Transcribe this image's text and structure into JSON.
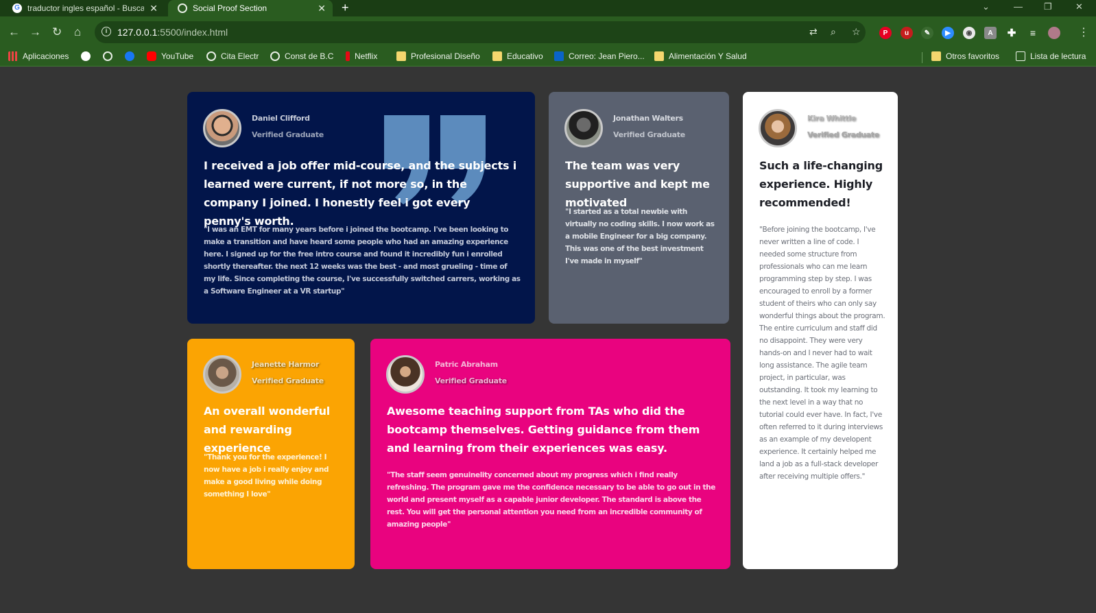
{
  "browser": {
    "tabs": [
      {
        "title": "traductor ingles español - Buscar",
        "active": false
      },
      {
        "title": "Social Proof Section",
        "active": true
      }
    ],
    "new_tab_label": "+",
    "address": {
      "host": "127.0.0.1",
      "rest": ":5500/index.html"
    },
    "bookmarks": [
      {
        "label": "Aplicaciones",
        "icon": "apps-grid-icon"
      },
      {
        "label": "",
        "icon": "google-icon"
      },
      {
        "label": "",
        "icon": "globe-icon"
      },
      {
        "label": "",
        "icon": "facebook-icon"
      },
      {
        "label": "YouTube",
        "icon": "youtube-icon"
      },
      {
        "label": "Cita Electr",
        "icon": "globe-icon"
      },
      {
        "label": "Const de B.C",
        "icon": "globe-icon"
      },
      {
        "label": "Netflix",
        "icon": "netflix-icon"
      },
      {
        "label": "Profesional Diseño",
        "icon": "folder-icon"
      },
      {
        "label": "Educativo",
        "icon": "folder-icon"
      },
      {
        "label": "Correo: Jean Piero...",
        "icon": "outlook-icon"
      },
      {
        "label": "Alimentación Y Salud",
        "icon": "folder-icon"
      }
    ],
    "other_bookmarks": "Otros favoritos",
    "reading_list": "Lista de lectura"
  },
  "colors": {
    "frame": "#1a3d14",
    "toolbar": "#2a5c20",
    "page_bg": "#353535",
    "card_daniel": "#02154a",
    "card_jonathan": "#5a6170",
    "card_kira": "#ffffff",
    "card_jeanette": "#fba403",
    "card_patric": "#e9037f",
    "quote_mark": "#5c8bbd"
  },
  "testimonials": {
    "daniel": {
      "name": "Daniel Clifford",
      "role": "Verified Graduate",
      "headline": "I received a job offer mid-course, and the subjects i learned were current, if not more so, in the company I joined. I honestly feel i got every penny's worth.",
      "body": "\"I was an EMT for many years before i joined the bootcamp. I've been looking to make a transition and have heard some people who had an amazing experience here. I signed up for the free intro course and found it incredibly fun i enrolled shortly thereafter. the next 12 weeks was the best - and most grueling - time of my life. Since completing the course, I've successfully switched carrers, working as a Software Engineer at a VR startup\""
    },
    "jonathan": {
      "name": "Jonathan Walters",
      "role": "Verified Graduate",
      "headline": "The team was very supportive and kept me motivated",
      "body": "\"I started as a total newbie with virtually no coding skills. I now work as a mobile Engineer for a big company. This was one of the best investment I've made in myself\""
    },
    "kira": {
      "name": "Kira Whittle",
      "role": "Verified Graduate",
      "headline": "Such a life-changing experience. Highly recommended!",
      "body": "\"Before joining the bootcamp, I've never written a line of code. I needed some structure from professionals who can me learn programming step by step. I was encouraged to enroll by a former student of theirs who can only say wonderful things about the program. The entire curriculum and staff did no disappoint. They were very hands-on and I never had to wait long assistance. The agile team project, in particular, was outstanding. It took my learning to the next level in a way that no tutorial could ever have. In fact, I've often referred to it during interviews as an example of my developent experience. It certainly helped me land a job as a full-stack developer after receiving multiple offers.\""
    },
    "jeanette": {
      "name": "Jeanette Harmor",
      "role": "Verified Graduate",
      "headline": "An overall wonderful and rewarding experience",
      "body": "\"Thank you for the experience! I now have a job i really enjoy and make a good living while doing something I love\""
    },
    "patric": {
      "name": "Patric Abraham",
      "role": "Verified Graduate",
      "headline": "Awesome teaching support from TAs who did the bootcamp themselves. Getting guidance from them and learning from their experiences was easy.",
      "body": "\"The staff seem genuinelity concerned about my progress which i find really refreshing. The program gave me the confidence necessary to be able to go out in the world and present myself as a capable junior developer. The standard is above the rest. You will get the personal attention you need from an incredible community of amazing people\""
    }
  }
}
